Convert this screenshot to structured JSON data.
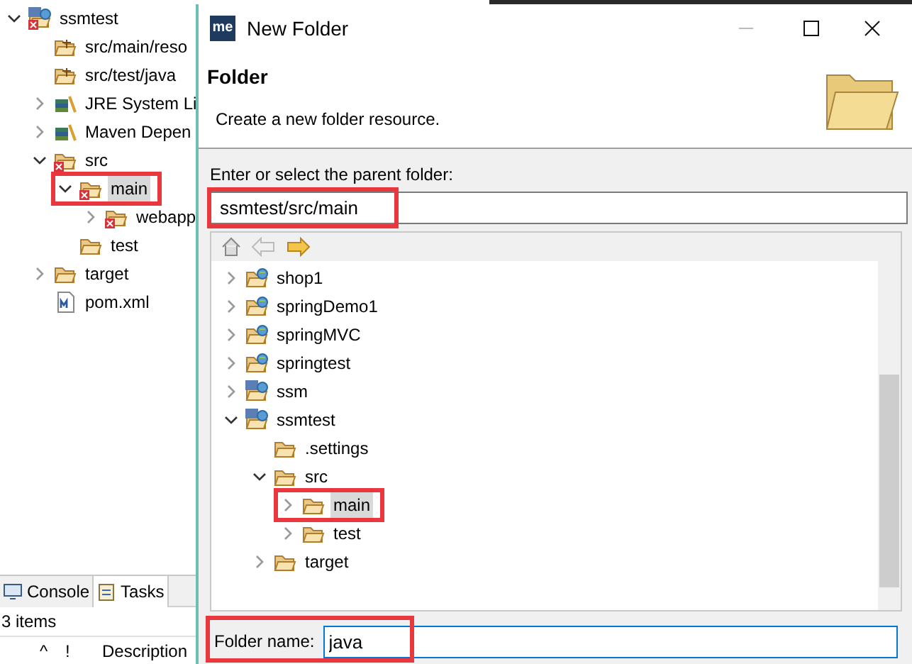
{
  "explorer": {
    "tree": [
      {
        "label": "ssmtest",
        "kind": "maven-project",
        "error": true,
        "expanded": true,
        "selected": false,
        "highlighted": false,
        "children": [
          {
            "label": "src/main/reso",
            "kind": "source-folder",
            "error": false,
            "selected": false,
            "highlighted": false
          },
          {
            "label": "src/test/java",
            "kind": "source-folder",
            "error": false,
            "selected": false,
            "highlighted": false
          },
          {
            "label": "JRE System Li",
            "kind": "library",
            "error": false,
            "expanded": false,
            "selected": false,
            "highlighted": false
          },
          {
            "label": "Maven Depen",
            "kind": "library",
            "error": false,
            "expanded": false,
            "selected": false,
            "highlighted": false
          },
          {
            "label": "src",
            "kind": "folder",
            "error": true,
            "expanded": true,
            "selected": false,
            "highlighted": false,
            "children": [
              {
                "label": "main",
                "kind": "folder",
                "error": true,
                "expanded": true,
                "selected": true,
                "highlighted": true,
                "children": [
                  {
                    "label": "webapp",
                    "kind": "folder",
                    "error": true,
                    "expanded": false,
                    "selected": false,
                    "highlighted": false
                  }
                ]
              },
              {
                "label": "test",
                "kind": "folder",
                "error": false,
                "selected": false,
                "highlighted": false
              }
            ]
          },
          {
            "label": "target",
            "kind": "folder",
            "error": false,
            "expanded": false,
            "selected": false,
            "highlighted": false
          },
          {
            "label": "pom.xml",
            "kind": "maven-file",
            "error": false,
            "selected": false,
            "highlighted": false
          }
        ]
      }
    ]
  },
  "bottom": {
    "tabs": [
      {
        "label": "Console",
        "selected": false
      },
      {
        "label": "Tasks",
        "selected": true
      }
    ],
    "item_count": "3 items",
    "columns": [
      "^",
      "!",
      "Description"
    ]
  },
  "dialog": {
    "title": "New Folder",
    "app_icon_text": "me",
    "heading": "Folder",
    "description": "Create a new folder resource.",
    "parent_label": "Enter or select the parent folder:",
    "parent_value": "ssmtest/src/main",
    "parent_highlighted": true,
    "tree": [
      {
        "label": "shop1",
        "kind": "web-project",
        "expanded": false,
        "selected": false,
        "highlighted": false
      },
      {
        "label": "springDemo1",
        "kind": "web-project",
        "expanded": false,
        "selected": false,
        "highlighted": false
      },
      {
        "label": "springMVC",
        "kind": "web-project",
        "expanded": false,
        "selected": false,
        "highlighted": false
      },
      {
        "label": "springtest",
        "kind": "web-project",
        "expanded": false,
        "selected": false,
        "highlighted": false
      },
      {
        "label": "ssm",
        "kind": "maven-project",
        "expanded": false,
        "selected": false,
        "highlighted": false
      },
      {
        "label": "ssmtest",
        "kind": "maven-project",
        "expanded": true,
        "selected": false,
        "highlighted": false,
        "children": [
          {
            "label": ".settings",
            "kind": "folder",
            "selected": false,
            "highlighted": false
          },
          {
            "label": "src",
            "kind": "folder",
            "expanded": true,
            "selected": false,
            "highlighted": false,
            "children": [
              {
                "label": "main",
                "kind": "folder",
                "expanded": false,
                "selected": true,
                "highlighted": true
              },
              {
                "label": "test",
                "kind": "folder",
                "expanded": false,
                "selected": false,
                "highlighted": false
              }
            ]
          },
          {
            "label": "target",
            "kind": "folder",
            "expanded": false,
            "selected": false,
            "highlighted": false
          }
        ]
      }
    ],
    "folder_name_label": "Folder name:",
    "folder_name_value": "java",
    "folder_name_highlighted": true
  }
}
